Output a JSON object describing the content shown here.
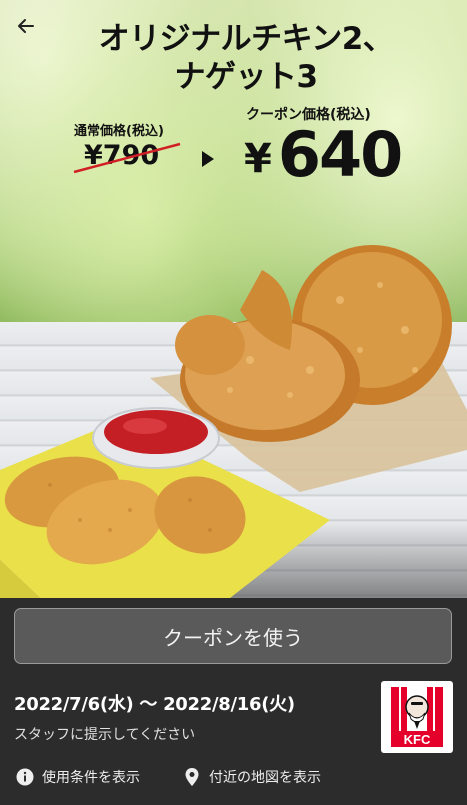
{
  "header": {
    "title_line1": "オリジナルチキン2、",
    "title_line2": "ナゲット3"
  },
  "pricing": {
    "regular_label": "通常価格(税込)",
    "regular_price": "¥790",
    "coupon_label": "クーポン価格(税込)",
    "coupon_currency": "¥",
    "coupon_amount": "640"
  },
  "actions": {
    "use_coupon_label": "クーポンを使う"
  },
  "validity": {
    "period": "2022/7/6(水) 〜 2022/8/16(火)",
    "note": "スタッフに提示してください"
  },
  "brand": {
    "logo_text": "KFC",
    "color": "#e4002b"
  },
  "footer": {
    "terms_label": "使用条件を表示",
    "map_label": "付近の地図を表示"
  },
  "icons": [
    "back-arrow-icon",
    "info-icon",
    "location-pin-icon"
  ]
}
